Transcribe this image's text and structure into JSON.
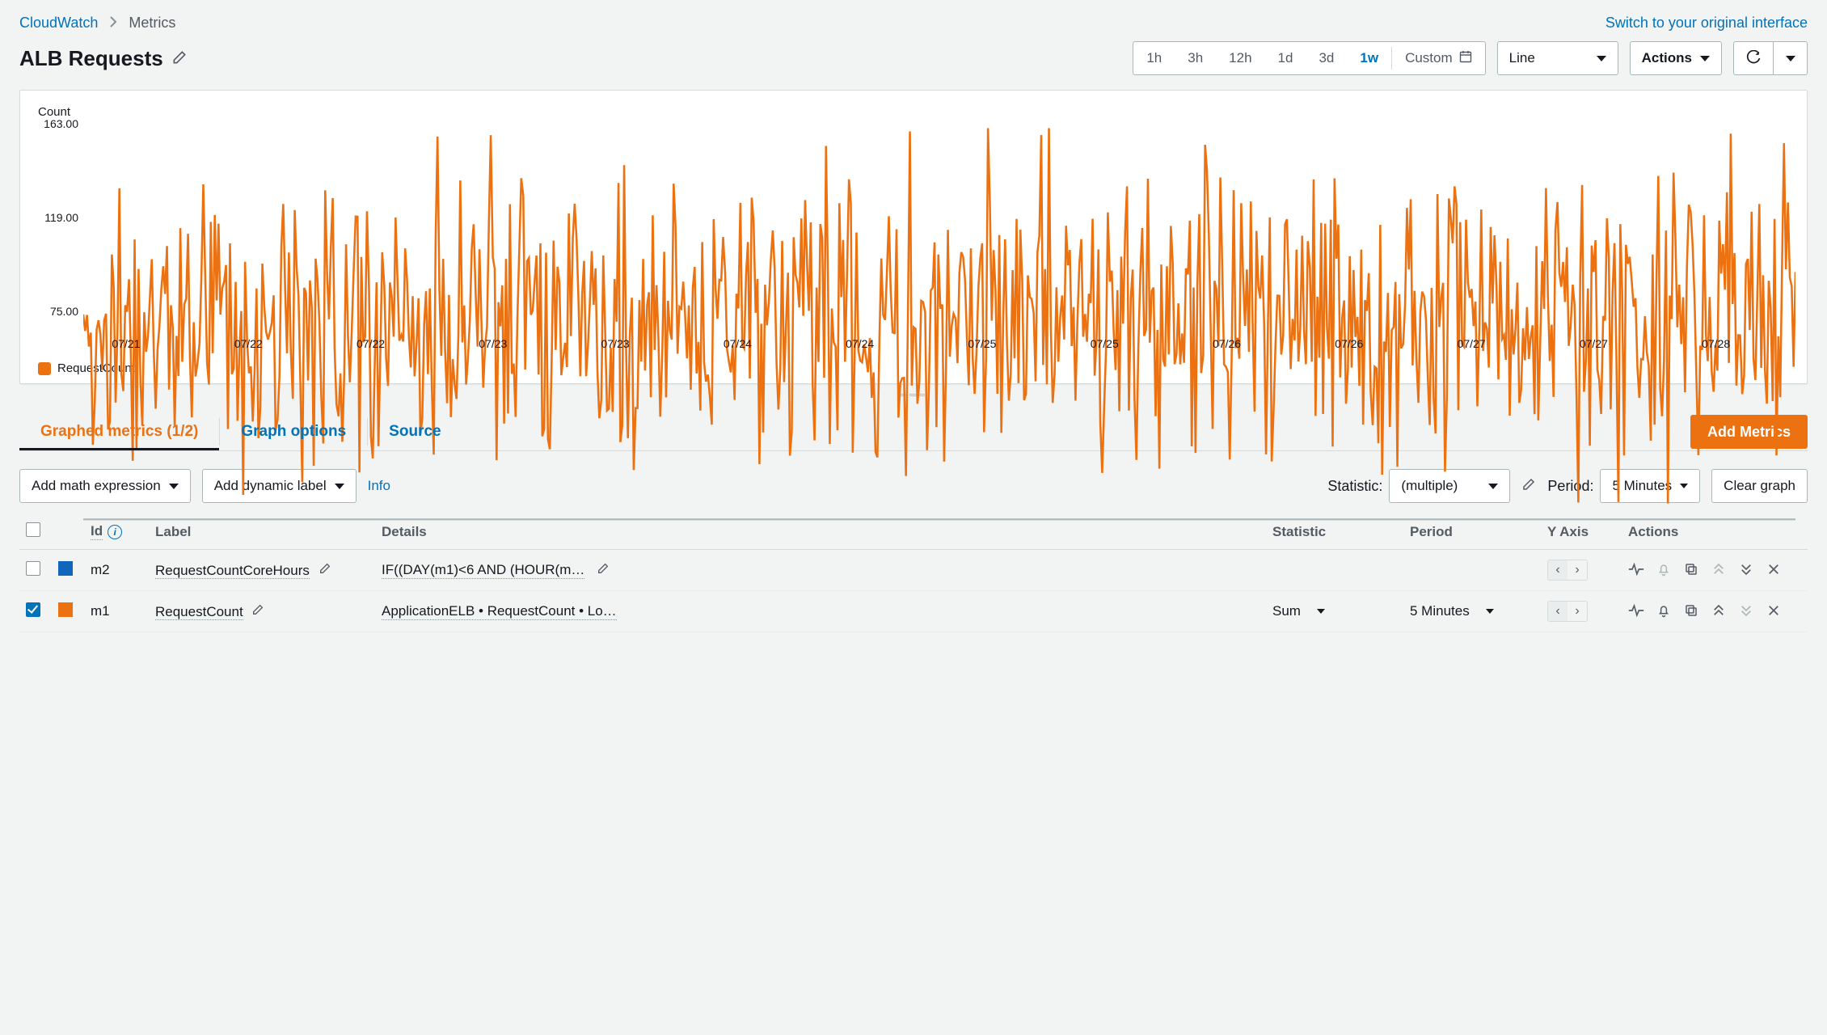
{
  "breadcrumb": {
    "root": "CloudWatch",
    "current": "Metrics"
  },
  "switch_link": "Switch to your original interface",
  "title": "ALB Requests",
  "time_range": {
    "options": [
      "1h",
      "3h",
      "12h",
      "1d",
      "3d",
      "1w"
    ],
    "active": "1w",
    "custom_label": "Custom"
  },
  "chart_type_select": "Line",
  "actions_label": "Actions",
  "chart_data": {
    "type": "line",
    "title": "",
    "ylabel": "Count",
    "ylim": [
      75,
      163
    ],
    "y_ticks": [
      75.0,
      119.0,
      163.0
    ],
    "x_ticks": [
      "07/21",
      "07/22",
      "07/22",
      "07/23",
      "07/23",
      "07/24",
      "07/24",
      "07/25",
      "07/25",
      "07/26",
      "07/26",
      "07/27",
      "07/27",
      "07/28"
    ],
    "series": [
      {
        "name": "RequestCount",
        "color": "#ec7211",
        "approx_mean": 119,
        "approx_min": 75,
        "approx_max": 163,
        "note": "dense ~5-min samples over 1 week; values oscillate mostly 95–145"
      }
    ]
  },
  "tabs": {
    "items": [
      "Graphed metrics (1/2)",
      "Graph options",
      "Source"
    ],
    "active_index": 0
  },
  "add_metrics_button": "Add Metrics",
  "subbar": {
    "add_math": "Add math expression",
    "add_dynamic": "Add dynamic label",
    "info": "Info",
    "statistic_label": "Statistic:",
    "statistic_value": "(multiple)",
    "period_label": "Period:",
    "period_value": "5 Minutes",
    "clear_graph": "Clear graph"
  },
  "table": {
    "headers": {
      "id": "Id",
      "label": "Label",
      "details": "Details",
      "statistic": "Statistic",
      "period": "Period",
      "yaxis": "Y Axis",
      "actions": "Actions"
    },
    "rows": [
      {
        "checked": false,
        "color": "blue",
        "id": "m2",
        "label": "RequestCountCoreHours",
        "details": "IF((DAY(m1)<6 AND (HOUR(m…",
        "details_editable": true,
        "statistic": "",
        "period": "",
        "yaxis_left": true,
        "actions_dim": {
          "alarm": true,
          "up": true,
          "down": false
        }
      },
      {
        "checked": true,
        "color": "orange",
        "id": "m1",
        "label": "RequestCount",
        "details": "ApplicationELB • RequestCount • Lo…",
        "details_editable": false,
        "statistic": "Sum",
        "period": "5 Minutes",
        "yaxis_left": true,
        "actions_dim": {
          "alarm": false,
          "up": false,
          "down": true
        }
      }
    ]
  }
}
